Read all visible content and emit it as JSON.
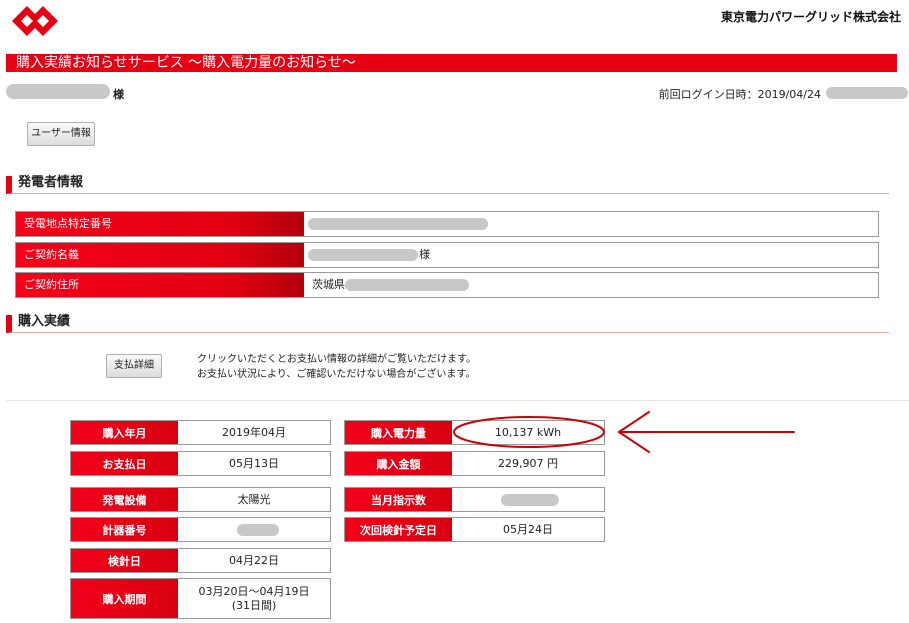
{
  "header": {
    "logo_icon": "tepco-diamond-logo",
    "company_name": "東京電力パワーグリッド株式会社",
    "brand_color": "#e60012"
  },
  "service_title": "購入実績お知らせサービス ～購入電力量のお知らせ～",
  "greeting": {
    "suffix": "様"
  },
  "last_login": {
    "text": "前回ログイン日時：2019/04/24"
  },
  "buttons": {
    "user_info": "ユーザー情報",
    "payment_detail": "支払詳細"
  },
  "generator_section": {
    "title": "発電者情報",
    "rows": [
      {
        "label": "受電地点特定番号",
        "value": ""
      },
      {
        "label": "ご契約名義",
        "value": "様"
      },
      {
        "label": "ご契約住所",
        "value": "茨城県"
      }
    ]
  },
  "purchase_section": {
    "title": "購入実績",
    "note_line1": "クリックいただくとお支払い情報の詳細がご覧いただけます。",
    "note_line2": "お支払い状況により、ご確認いただけない場合がございます。"
  },
  "purchase_table": {
    "left": [
      {
        "label": "購入年月",
        "value": "2019年04月"
      },
      {
        "label": "お支払日",
        "value": "05月13日"
      },
      {
        "label": "発電設備",
        "value": "太陽光"
      },
      {
        "label": "計器番号",
        "value": ""
      },
      {
        "label": "検針日",
        "value": "04月22日"
      },
      {
        "label": "購入期間",
        "value": "03月20日～04月19日",
        "value2": "(31日間)"
      }
    ],
    "right": [
      {
        "label": "購入電力量",
        "value": "10,137 kWh"
      },
      {
        "label": "購入金額",
        "value": "229,907 円"
      },
      {
        "label": "当月指示数",
        "value": ""
      },
      {
        "label": "次回検針予定日",
        "value": "05月24日"
      }
    ]
  },
  "annotation": {
    "circle_color": "#d00000",
    "arrow_icon": "left-arrow-icon"
  }
}
